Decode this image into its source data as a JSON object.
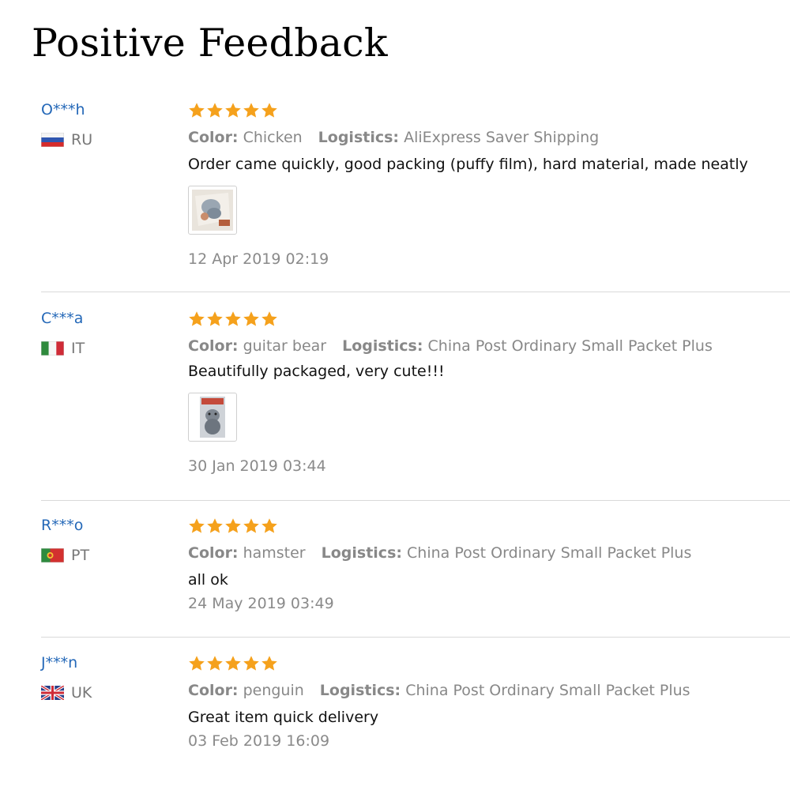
{
  "page": {
    "title": "Positive Feedback"
  },
  "colors": {
    "username": "#2468b8",
    "star": "#f5a11c",
    "meta": "#888888",
    "divider": "#d9d9d9"
  },
  "labels": {
    "color_key": "Color:",
    "logistics_key": "Logistics:"
  },
  "reviews": [
    {
      "user": "O***h",
      "country": "RU",
      "flag_icon": "russia-flag-icon",
      "rating": 5,
      "color": "Chicken",
      "logistics": "AliExpress Saver Shipping",
      "comment": "Order came quickly, good packing (puffy film), hard material, made neatly",
      "has_photo": true,
      "date": "12 Apr 2019 02:19"
    },
    {
      "user": "C***a",
      "country": "IT",
      "flag_icon": "italy-flag-icon",
      "rating": 5,
      "color": "guitar bear",
      "logistics": "China Post Ordinary Small Packet Plus",
      "comment": "Beautifully packaged, very cute!!!",
      "has_photo": true,
      "date": "30 Jan 2019 03:44"
    },
    {
      "user": "R***o",
      "country": "PT",
      "flag_icon": "portugal-flag-icon",
      "rating": 5,
      "color": "hamster",
      "logistics": "China Post Ordinary Small Packet Plus",
      "comment": "all ok",
      "has_photo": false,
      "date": "24 May 2019 03:49"
    },
    {
      "user": "J***n",
      "country": "UK",
      "flag_icon": "uk-flag-icon",
      "rating": 5,
      "color": "penguin",
      "logistics": "China Post Ordinary Small Packet Plus",
      "comment": "Great item quick delivery",
      "has_photo": false,
      "date": "03 Feb 2019 16:09"
    }
  ]
}
